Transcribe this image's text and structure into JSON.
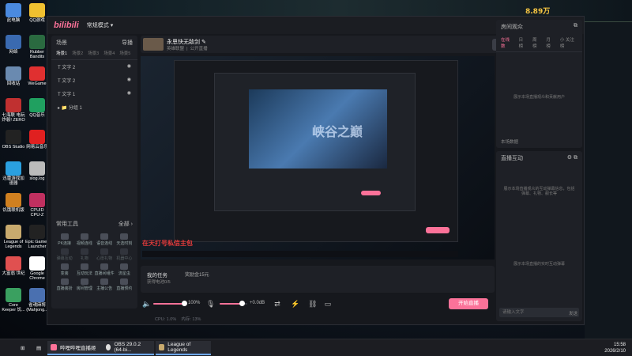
{
  "desktop": {
    "left_icons": [
      "此电脑",
      "网络",
      "回收站",
      "七海联 电玩 炸裂! ZERO",
      "OBS Studio",
      "迅雷游戏加速器",
      "饥饿联机版",
      "League of Legends",
      "大富翁 世纪",
      "Core Keeper 饥..."
    ],
    "right_icons": [
      "QQ游戏",
      "Rubber Bandits",
      "WeGame",
      "QQ音乐",
      "网易云音乐",
      "slog.log",
      "CPUID CPU-Z",
      "Epic Games Launcher",
      "Google Chrome",
      "雀魂麻将 (Mahjong..."
    ],
    "hud_coins": "8.89万"
  },
  "window": {
    "logo": "bilibili",
    "mode_label": "常规模式 ▾",
    "scenes": {
      "title": "场景",
      "import_label": "导播",
      "tabs": [
        "场景1",
        "场景2",
        "场景3",
        "场景4",
        "场景5"
      ],
      "sources": [
        "文字 2",
        "文字 2",
        "文字 1"
      ],
      "group": "分组 1",
      "footer": [
        "素材",
        "场景",
        "转场",
        "清空"
      ]
    },
    "tools": {
      "title": "常用工具",
      "more": "全部 ›",
      "items": [
        "PK连接",
        "视频连线",
        "语音连线",
        "天选时刻",
        "弹幕互动",
        "礼物",
        "心愿礼物",
        "机器中心",
        "变装",
        "互动玩法",
        "直播间组件",
        "流星虫",
        "直播装扮",
        "房间管理",
        "主播公告",
        "直播预约"
      ]
    },
    "stream_header": {
      "title": "永恩快无敌剑",
      "category": "英雄联盟",
      "visibility": "公开直播",
      "quality": [
        "横屏",
        "竖屏"
      ]
    },
    "preview": {
      "overlay_text": "在天打号私信主包"
    },
    "task": {
      "title": "我的任务",
      "reward": "奖励金15元",
      "progress": "获得电池0/5"
    },
    "audio": {
      "speaker_volume": "100%",
      "mic_volume": "+0.0dB",
      "start_label": "开始直播"
    },
    "status": {
      "cpu": "CPU: 1.0%",
      "mem": "内存: 13%"
    },
    "room": {
      "title": "房间观众",
      "tabs": [
        "在线数",
        "日榜",
        "周榜",
        "月榜",
        "小 关注榜"
      ],
      "empty": "展示本场直播观众和贡献用户",
      "footer": "本场数据"
    },
    "interact": {
      "title": "直播互动",
      "empty1": "展示本场直播观众的互动弹幕信息，包括弹幕、礼物、舰长等",
      "empty2": "展示本场直播的实时互动弹幕",
      "input_placeholder": "请输入文字",
      "send": "发送"
    }
  },
  "taskbar": {
    "apps": [
      "哔哩哔哩直播姬",
      "OBS 29.0.2 (64-bi...",
      "League of Legends"
    ],
    "time": "15:58",
    "date": "2026/2/10"
  },
  "colors": {
    "accent": "#fb7299",
    "panel": "#1e2026",
    "window": "#16181d"
  }
}
